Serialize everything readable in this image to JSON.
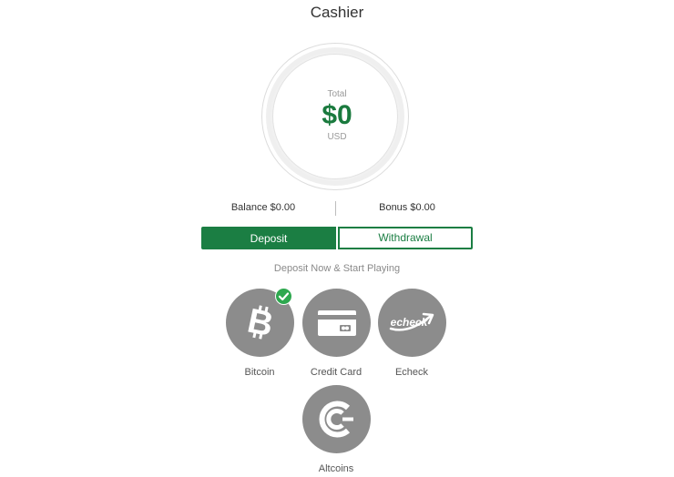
{
  "page": {
    "title": "Cashier"
  },
  "summary": {
    "total_label": "Total",
    "total_amount": "$0",
    "currency": "USD",
    "balance": "Balance $0.00",
    "bonus": "Bonus $0.00"
  },
  "tabs": {
    "deposit": "Deposit",
    "withdrawal": "Withdrawal",
    "active": "deposit"
  },
  "deposit": {
    "subtitle": "Deposit Now & Start Playing",
    "methods": [
      {
        "label": "Bitcoin",
        "icon": "bitcoin-icon",
        "selected": true
      },
      {
        "label": "Credit Card",
        "icon": "credit-card-icon",
        "selected": false
      },
      {
        "label": "Echeck",
        "icon": "echeck-icon",
        "selected": false
      },
      {
        "label": "Altcoins",
        "icon": "altcoins-icon",
        "selected": false
      }
    ],
    "echeck_logo_text": "echeck"
  },
  "colors": {
    "brand_green": "#1b7e43",
    "amount_green": "#1a7a3e",
    "check_green": "#2ea84f",
    "method_gray": "#8c8c8c"
  }
}
